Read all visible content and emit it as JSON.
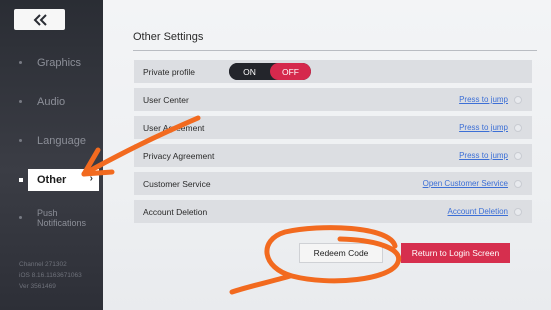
{
  "sidebar": {
    "back_icon": "double-chevron-left-icon",
    "items": [
      {
        "label": "Graphics"
      },
      {
        "label": "Audio"
      },
      {
        "label": "Language"
      },
      {
        "label": "Other",
        "chevron": "›"
      },
      {
        "label": "Push Notifications"
      }
    ],
    "build_info": {
      "channel": "Channel 271302",
      "ios": "iOS 8.16.1163671063",
      "ver": "Ver 3561469"
    }
  },
  "main": {
    "section_title": "Other Settings",
    "private_profile": {
      "label": "Private profile",
      "on": "ON",
      "off": "OFF",
      "selected": "OFF"
    },
    "rows": [
      {
        "label": "User Center",
        "link": "Press to jump"
      },
      {
        "label": "User Agreement",
        "link": "Press to jump"
      },
      {
        "label": "Privacy Agreement",
        "link": "Press to jump"
      },
      {
        "label": "Customer Service",
        "link": "Open Customer Service"
      },
      {
        "label": "Account Deletion",
        "link": "Account Deletion"
      }
    ],
    "redeem_button": "Redeem Code",
    "login_button": "Return to Login Screen"
  },
  "colors": {
    "accent_red": "#d5294d",
    "link_blue": "#3c6fd6",
    "annotation_orange": "#f26a1f"
  }
}
